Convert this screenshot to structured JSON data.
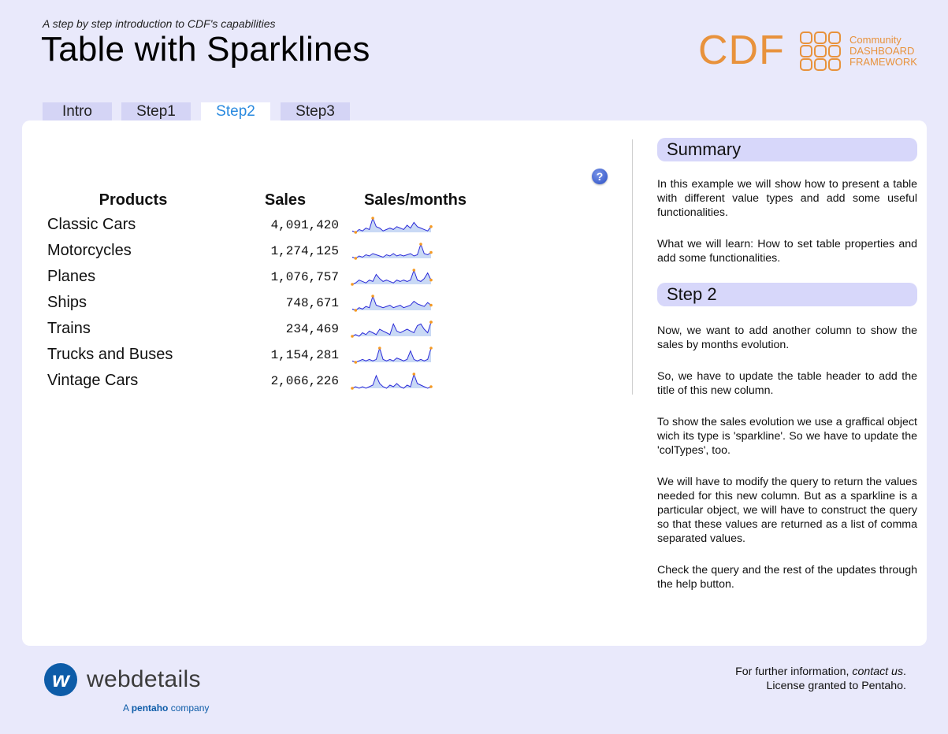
{
  "header": {
    "subtitle": "A step by step introduction to CDF's capabilities",
    "title": "Table with Sparklines"
  },
  "logo": {
    "name": "CDF",
    "tagline": [
      "Community",
      "DASHBOARD",
      "FRAMEWORK"
    ],
    "color": "#e8923c"
  },
  "tabs": [
    {
      "label": "Intro",
      "active": false
    },
    {
      "label": "Step1",
      "active": false
    },
    {
      "label": "Step2",
      "active": true
    },
    {
      "label": "Step3",
      "active": false
    }
  ],
  "help_icon": "question-icon",
  "table": {
    "headers": [
      "Products",
      "Sales",
      "Sales/months"
    ],
    "rows": [
      {
        "product": "Classic Cars",
        "sales": "4,091,420",
        "spark": [
          3,
          2,
          4,
          3,
          5,
          4,
          12,
          6,
          5,
          3,
          4,
          5,
          4,
          6,
          5,
          4,
          7,
          5,
          9,
          6,
          5,
          4,
          3,
          6
        ]
      },
      {
        "product": "Motorcycles",
        "sales": "1,274,125",
        "spark": [
          3,
          2,
          4,
          3,
          5,
          4,
          6,
          5,
          4,
          3,
          5,
          4,
          6,
          4,
          5,
          4,
          5,
          6,
          4,
          5,
          14,
          6,
          5,
          7
        ]
      },
      {
        "product": "Planes",
        "sales": "1,076,757",
        "spark": [
          2,
          3,
          5,
          4,
          3,
          5,
          4,
          9,
          6,
          4,
          5,
          4,
          3,
          5,
          4,
          5,
          4,
          5,
          12,
          5,
          4,
          6,
          10,
          5
        ]
      },
      {
        "product": "Ships",
        "sales": "748,671",
        "spark": [
          3,
          2,
          4,
          3,
          5,
          4,
          13,
          6,
          5,
          4,
          5,
          6,
          4,
          5,
          6,
          4,
          5,
          6,
          9,
          7,
          6,
          5,
          8,
          6
        ]
      },
      {
        "product": "Trains",
        "sales": "234,469",
        "spark": [
          2,
          3,
          2,
          4,
          3,
          5,
          4,
          3,
          6,
          5,
          4,
          3,
          9,
          5,
          4,
          5,
          6,
          5,
          4,
          8,
          9,
          6,
          4,
          10
        ]
      },
      {
        "product": "Trucks and Buses",
        "sales": "1,154,281",
        "spark": [
          3,
          2,
          3,
          4,
          3,
          4,
          3,
          4,
          12,
          4,
          3,
          4,
          3,
          5,
          4,
          3,
          4,
          10,
          4,
          3,
          4,
          3,
          4,
          12
        ]
      },
      {
        "product": "Vintage Cars",
        "sales": "2,066,226",
        "spark": [
          3,
          4,
          3,
          4,
          3,
          4,
          5,
          11,
          6,
          4,
          3,
          5,
          4,
          6,
          4,
          3,
          5,
          4,
          12,
          6,
          5,
          4,
          3,
          4
        ]
      }
    ],
    "spark_color": "#2b2bd8",
    "spark_fill": "#c9d9f5",
    "spark_marker": "#f59a23"
  },
  "sidebar": {
    "summary_title": "Summary",
    "summary_paragraphs": [
      "In this example we will show how to present a table with different value types and add some useful functionalities.",
      "What we will learn: How to set table properties and add some functionalities."
    ],
    "step_title": "Step 2",
    "step_paragraphs": [
      "Now, we want to add another column to show the sales by months evolution.",
      "So, we have to update the table header to add the title of this new column.",
      "To show the sales evolution we use a graffical object wich its type is 'sparkline'. So we have to update the 'colTypes', too.",
      "We will have to modify the query to return the values needed for this new column. But as a sparkline is a particular object, we will have to construct the query so that these values are returned as a list of comma separated values.",
      "Check the query and the rest of the updates through the help button."
    ]
  },
  "footer": {
    "brand": "webdetails",
    "brand_mark": "w",
    "brand_tag_prefix": "A",
    "brand_tag_company": "pentaho",
    "brand_tag_suffix": "company",
    "info_prefix": "For further information,",
    "info_link": "contact us",
    "info_suffix": ".",
    "license": "License granted to Pentaho."
  }
}
